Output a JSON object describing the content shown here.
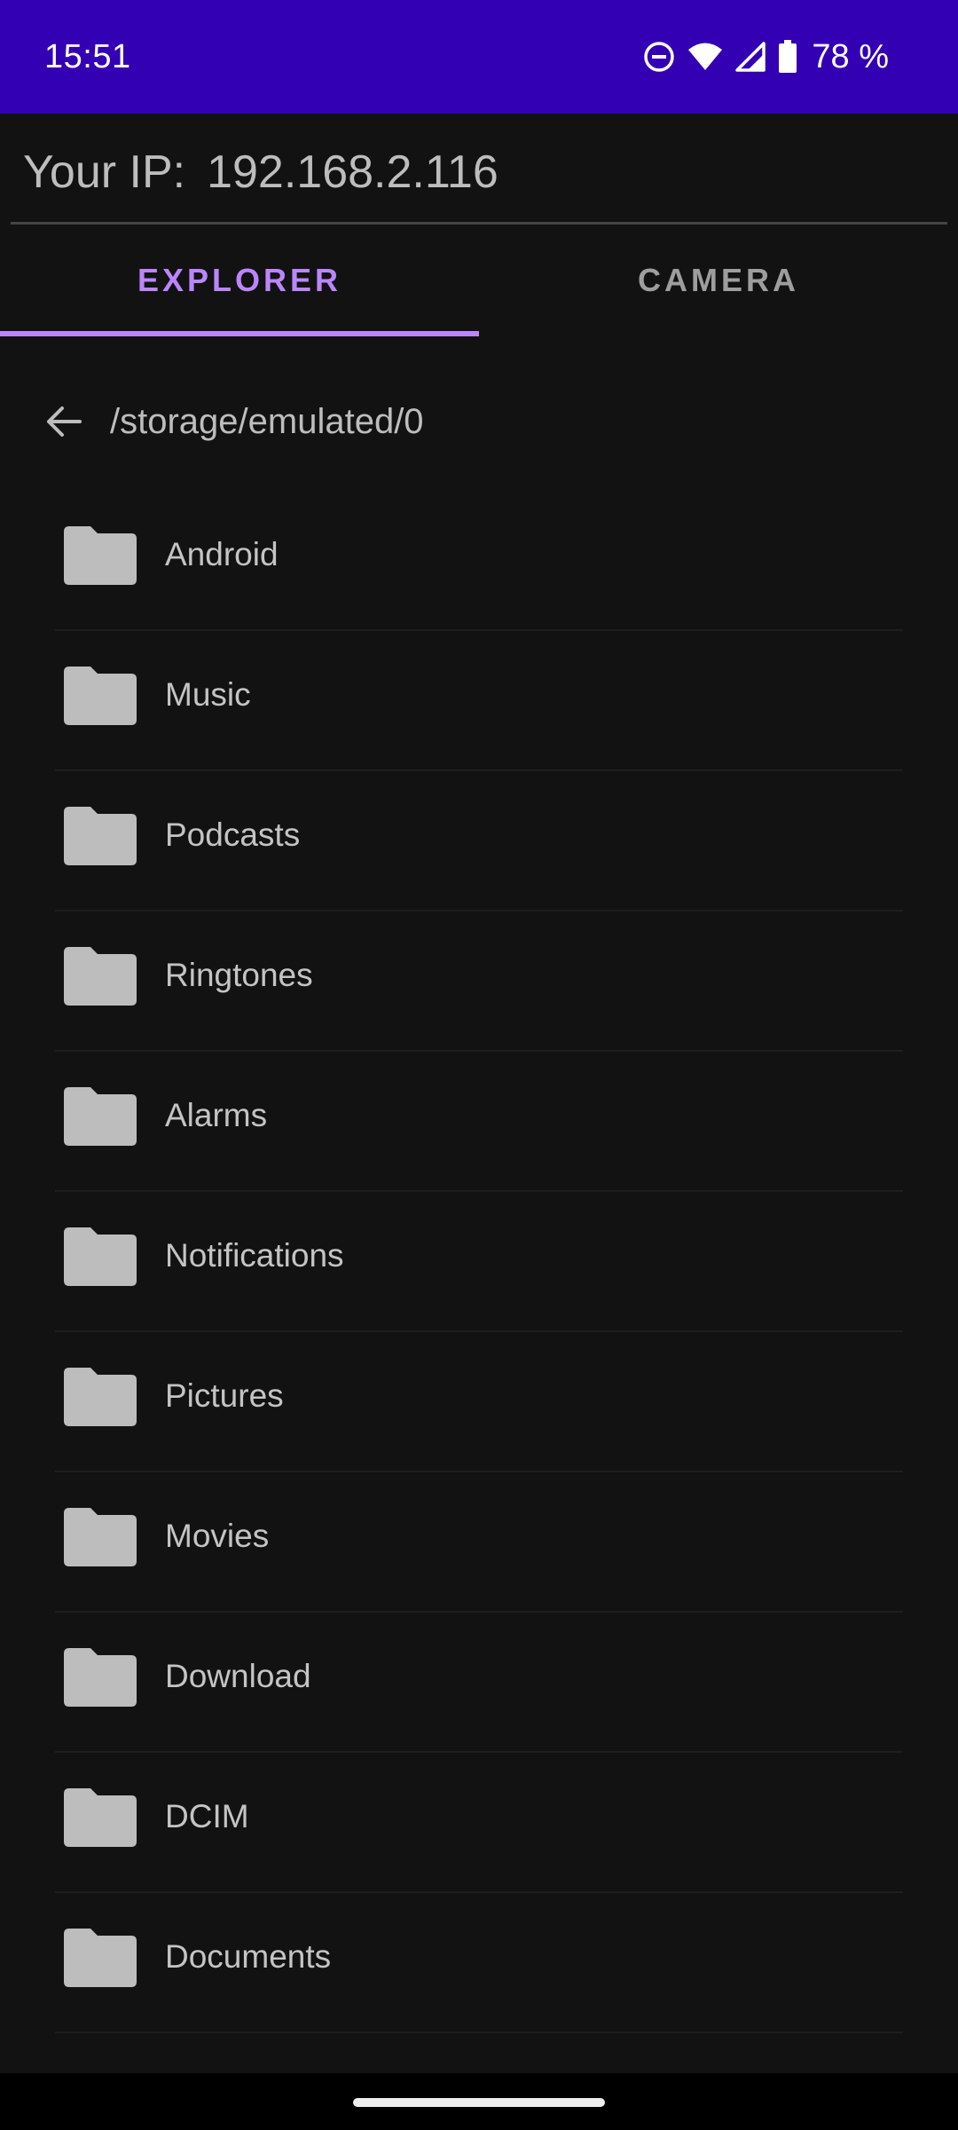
{
  "status_bar": {
    "time": "15:51",
    "battery": "78 %",
    "icons": [
      "do-not-disturb-icon",
      "wifi-icon",
      "signal-icon",
      "battery-icon"
    ],
    "background": "#3300b3"
  },
  "header": {
    "ip_label": "Your IP:",
    "ip_value": "192.168.2.116"
  },
  "tabs": [
    {
      "label": "EXPLORER",
      "selected": true
    },
    {
      "label": "CAMERA",
      "selected": false
    }
  ],
  "explorer": {
    "path": "/storage/emulated/0",
    "back_icon": "arrow-back-icon",
    "folder_icon": "folder-icon",
    "folders": [
      {
        "name": "Android"
      },
      {
        "name": "Music"
      },
      {
        "name": "Podcasts"
      },
      {
        "name": "Ringtones"
      },
      {
        "name": "Alarms"
      },
      {
        "name": "Notifications"
      },
      {
        "name": "Pictures"
      },
      {
        "name": "Movies"
      },
      {
        "name": "Download"
      },
      {
        "name": "DCIM"
      },
      {
        "name": "Documents"
      }
    ]
  },
  "colors": {
    "accent": "#bb86fc",
    "background": "#121212",
    "folder": "#bdbdbd"
  }
}
